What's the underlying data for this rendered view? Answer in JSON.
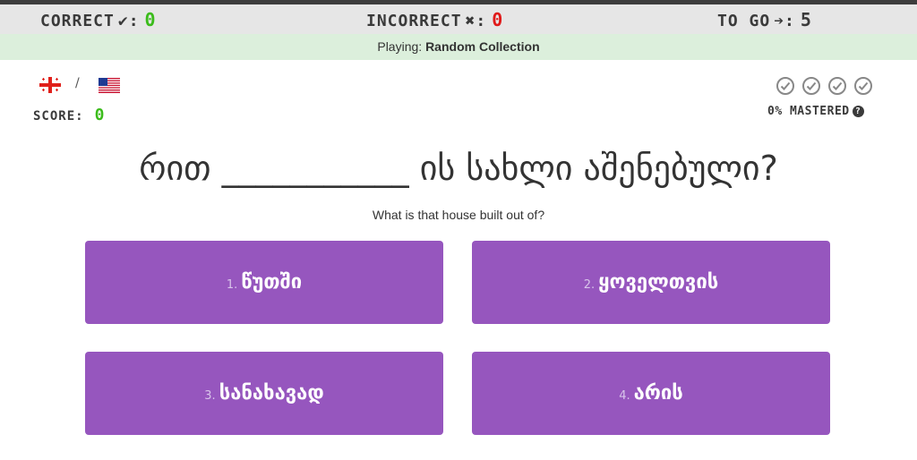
{
  "stats": {
    "correct_label": "CORRECT",
    "correct_symbol": "✔:",
    "correct_value": "0",
    "incorrect_label": "INCORRECT",
    "incorrect_symbol": "✖:",
    "incorrect_value": "0",
    "togo_label": "TO GO",
    "togo_symbol": "➔:",
    "togo_value": "5"
  },
  "playing": {
    "prefix": "Playing:",
    "collection": "Random Collection"
  },
  "languages": {
    "from_flag": "georgia-flag-icon",
    "separator": "/",
    "to_flag": "usa-flag-icon"
  },
  "score": {
    "label": "SCORE:",
    "value": "0"
  },
  "mastery": {
    "label": "0% MASTERED",
    "help": "?",
    "checks_total": 4
  },
  "question": {
    "before": "რით",
    "blank": "___________",
    "after": "ის სახლი აშენებული?",
    "translation": "What is that house built out of?"
  },
  "answers": [
    {
      "index": "1.",
      "text": "წუთში"
    },
    {
      "index": "2.",
      "text": "ყოველთვის"
    },
    {
      "index": "3.",
      "text": "სანახავად"
    },
    {
      "index": "4.",
      "text": "არის"
    }
  ],
  "colors": {
    "answer_bg": "#9656be",
    "correct_green": "#3cbc1c",
    "incorrect_red": "#e01a1a",
    "playing_bg": "#dcefdc",
    "stats_bg": "#e6e6e6"
  }
}
